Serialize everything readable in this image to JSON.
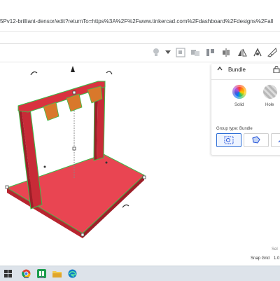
{
  "browser": {
    "url": "5Pv12-brilliant-densor/edit?returnTo=https%3A%2F%2Fwww.tinkercad.com%2Fdashboard%2Fdesigns%2Fall"
  },
  "toolbar": {
    "icons": [
      "lightbulb-icon",
      "dropdown-icon",
      "group-icon",
      "ungroup-icon",
      "align-icon",
      "mirror-icon",
      "cruise-icon",
      "workplane-ruler-icon"
    ]
  },
  "inspector": {
    "title": "Bundle",
    "solid_label": "Solid",
    "hole_label": "Hole",
    "group_type_label": "Group type: Bundle"
  },
  "viewport": {
    "snap_grid_label": "Snap Grid",
    "snap_value": "1.0",
    "settings_value": "Sel"
  },
  "colors": {
    "model_red": "#e33a44",
    "selection_green": "#3bbf4b",
    "bucket_orange": "#d9782b",
    "accent_blue": "#2f6fd6"
  },
  "taskbar": {
    "icons": [
      "start-icon",
      "search-icon",
      "chrome-icon",
      "file-explorer-icon",
      "edge-icon"
    ]
  }
}
